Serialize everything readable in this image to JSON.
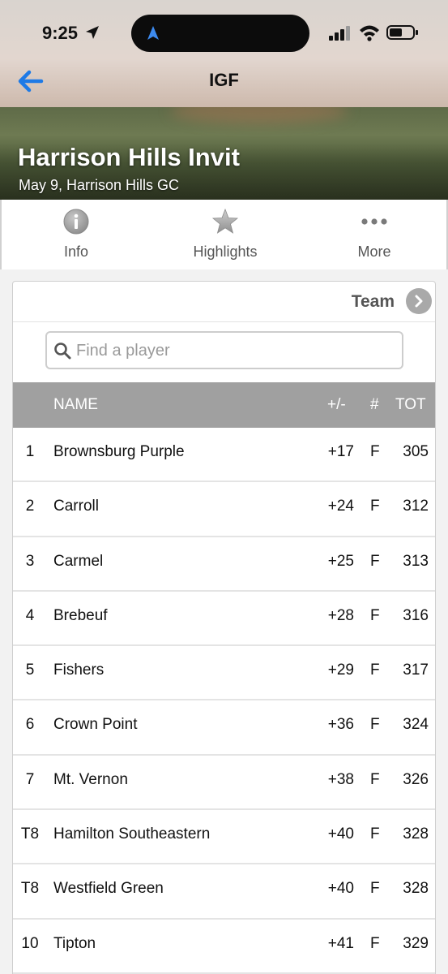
{
  "status_bar": {
    "time": "9:25"
  },
  "nav": {
    "title": "IGF",
    "back_icon": "back-arrow-icon"
  },
  "event": {
    "title": "Harrison Hills Invit",
    "subtitle": "May 9, Harrison Hills GC"
  },
  "tabs": [
    {
      "label": "Info",
      "icon": "info-icon"
    },
    {
      "label": "Highlights",
      "icon": "star-icon"
    },
    {
      "label": "More",
      "icon": "more-dots-icon"
    }
  ],
  "team_toggle": {
    "label": "Team"
  },
  "search": {
    "placeholder": "Find a player"
  },
  "table": {
    "headers": {
      "pos": "",
      "name": "NAME",
      "plus_minus": "+/-",
      "hole": "#",
      "total": "TOT"
    },
    "rows": [
      {
        "pos": "1",
        "name": "Brownsburg Purple",
        "plus_minus": "+17",
        "hole": "F",
        "total": "305"
      },
      {
        "pos": "2",
        "name": "Carroll",
        "plus_minus": "+24",
        "hole": "F",
        "total": "312"
      },
      {
        "pos": "3",
        "name": "Carmel",
        "plus_minus": "+25",
        "hole": "F",
        "total": "313"
      },
      {
        "pos": "4",
        "name": "Brebeuf",
        "plus_minus": "+28",
        "hole": "F",
        "total": "316"
      },
      {
        "pos": "5",
        "name": "Fishers",
        "plus_minus": "+29",
        "hole": "F",
        "total": "317"
      },
      {
        "pos": "6",
        "name": "Crown Point",
        "plus_minus": "+36",
        "hole": "F",
        "total": "324"
      },
      {
        "pos": "7",
        "name": "Mt. Vernon",
        "plus_minus": "+38",
        "hole": "F",
        "total": "326"
      },
      {
        "pos": "T8",
        "name": "Hamilton Southeastern",
        "plus_minus": "+40",
        "hole": "F",
        "total": "328"
      },
      {
        "pos": "T8",
        "name": "Westfield Green",
        "plus_minus": "+40",
        "hole": "F",
        "total": "328"
      },
      {
        "pos": "10",
        "name": "Tipton",
        "plus_minus": "+41",
        "hole": "F",
        "total": "329"
      }
    ]
  },
  "colors": {
    "accent": "#1e7ae6",
    "table_header": "#a0a0a0"
  }
}
